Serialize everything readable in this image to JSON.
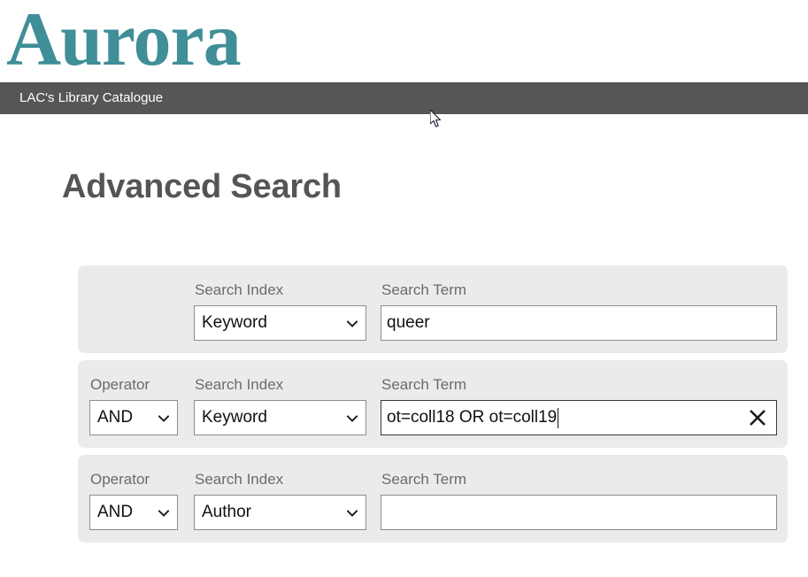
{
  "brand": {
    "wordmark": "Aurora",
    "wordmark_color": "#3f8e98",
    "catalogue_bar_label": "LAC's Library Catalogue",
    "catalogue_bar_color": "#565656"
  },
  "page": {
    "title": "Advanced Search",
    "title_color": "#555555",
    "panel_color": "#ebebeb"
  },
  "labels": {
    "operator": "Operator",
    "search_index": "Search Index",
    "search_term": "Search Term"
  },
  "icons": {
    "chevron_down": "chevron-down-icon",
    "clear": "close-x-icon",
    "pointer": "mouse-pointer-icon"
  },
  "search_rows": [
    {
      "has_operator": false,
      "operator_label": "",
      "operator_value": "",
      "index_label": "Search Index",
      "index_value": "Keyword",
      "term_label": "Search Term",
      "term_value": "queer",
      "term_placeholder": "",
      "focused": false,
      "has_clear": false
    },
    {
      "has_operator": true,
      "operator_label": "Operator",
      "operator_value": "AND",
      "index_label": "Search Index",
      "index_value": "Keyword",
      "term_label": "Search Term",
      "term_value": "ot=coll18 OR ot=coll19",
      "term_placeholder": "",
      "focused": true,
      "has_clear": true
    },
    {
      "has_operator": true,
      "operator_label": "Operator",
      "operator_value": "AND",
      "index_label": "Search Index",
      "index_value": "Author",
      "term_label": "Search Term",
      "term_value": "",
      "term_placeholder": "",
      "focused": false,
      "has_clear": false
    }
  ]
}
